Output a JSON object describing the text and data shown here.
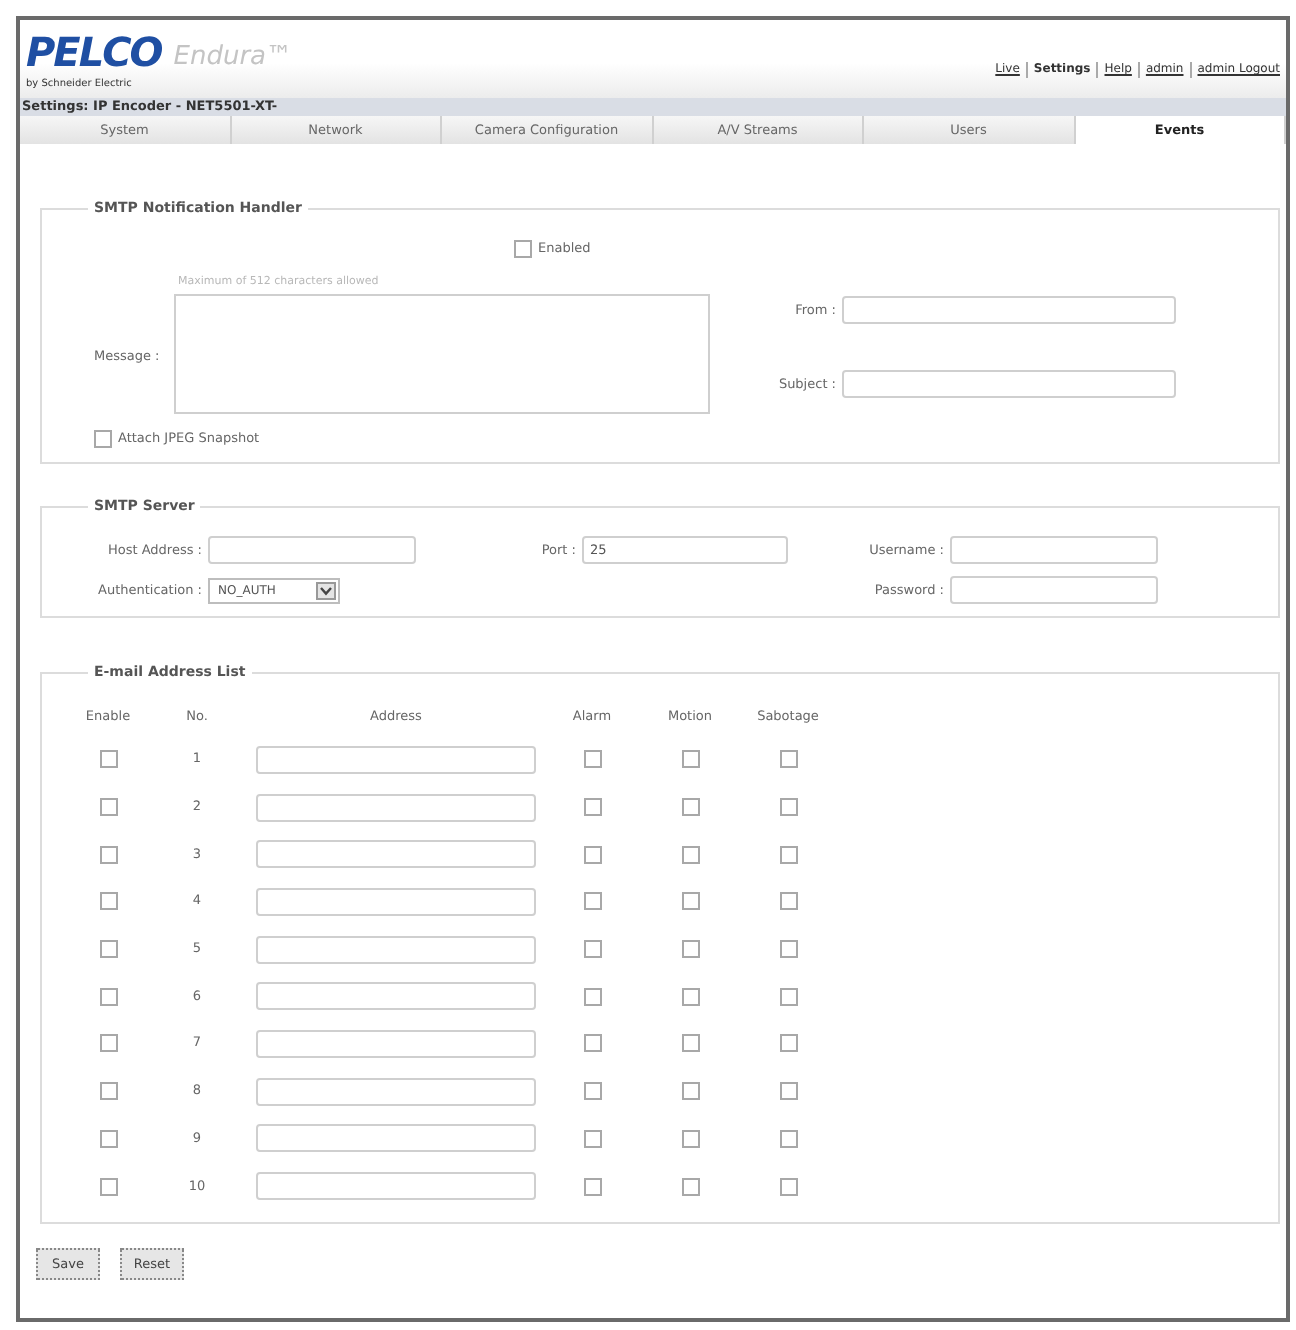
{
  "header": {
    "logo": "PELCO",
    "product": "Endura™",
    "tagline": "by Schneider Electric",
    "nav_links": [
      {
        "label": "Live",
        "selected": false
      },
      {
        "label": "Settings",
        "selected": true
      },
      {
        "label": "Help",
        "selected": false
      },
      {
        "label": "admin",
        "selected": false
      },
      {
        "label": "admin Logout",
        "selected": false
      }
    ]
  },
  "breadcrumb": "Settings: IP Encoder - NET5501-XT-",
  "tabs": [
    {
      "label": "System",
      "selected": false
    },
    {
      "label": "Network",
      "selected": false
    },
    {
      "label": "Camera Configuration",
      "selected": false
    },
    {
      "label": "A/V Streams",
      "selected": false
    },
    {
      "label": "Users",
      "selected": false
    },
    {
      "label": "Events",
      "selected": true
    }
  ],
  "smtp_notification": {
    "legend": "SMTP Notification Handler",
    "enabled": {
      "label": "Enabled",
      "checked": false
    },
    "message_hint": "Maximum of 512 characters allowed",
    "message_label": "Message :",
    "from_label": "From :",
    "subject_label": "Subject :",
    "attach": {
      "label": "Attach JPEG Snapshot",
      "checked": false
    }
  },
  "smtp_server": {
    "legend": "SMTP Server",
    "host_label": "Host Address :",
    "port_label": "Port :",
    "port_value": "25",
    "username_label": "Username :",
    "auth_label": "Authentication :",
    "auth_value": "NO_AUTH",
    "password_label": "Password :"
  },
  "email_list": {
    "legend": "E-mail Address List",
    "columns": [
      "Enable",
      "No.",
      "Address",
      "Alarm",
      "Motion",
      "Sabotage"
    ],
    "rows": [
      {
        "no": "1",
        "enable": false,
        "alarm": false,
        "motion": false,
        "sabotage": false
      },
      {
        "no": "2",
        "enable": false,
        "alarm": false,
        "motion": false,
        "sabotage": false
      },
      {
        "no": "3",
        "enable": false,
        "alarm": false,
        "motion": false,
        "sabotage": false
      },
      {
        "no": "4",
        "enable": false,
        "alarm": false,
        "motion": false,
        "sabotage": false
      },
      {
        "no": "5",
        "enable": false,
        "alarm": false,
        "motion": false,
        "sabotage": false
      },
      {
        "no": "6",
        "enable": false,
        "alarm": false,
        "motion": false,
        "sabotage": false
      },
      {
        "no": "7",
        "enable": false,
        "alarm": false,
        "motion": false,
        "sabotage": false
      },
      {
        "no": "8",
        "enable": false,
        "alarm": false,
        "motion": false,
        "sabotage": false
      },
      {
        "no": "9",
        "enable": false,
        "alarm": false,
        "motion": false,
        "sabotage": false
      },
      {
        "no": "10",
        "enable": false,
        "alarm": false,
        "motion": false,
        "sabotage": false
      }
    ]
  },
  "buttons": [
    "Save",
    "Reset"
  ]
}
